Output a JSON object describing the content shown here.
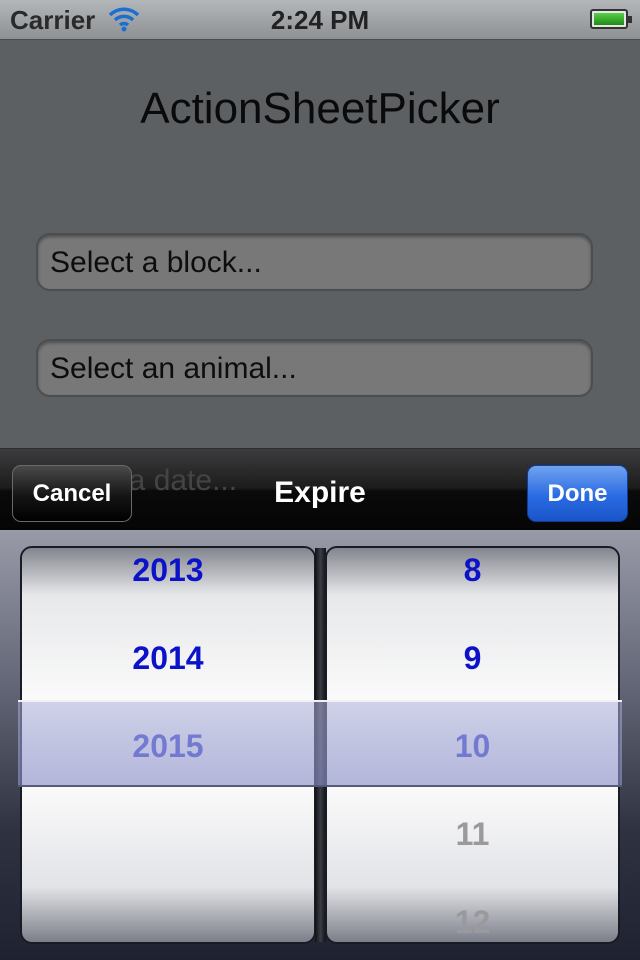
{
  "status_bar": {
    "carrier": "Carrier",
    "time": "2:24 PM"
  },
  "screen": {
    "title": "ActionSheetPicker",
    "fields": [
      "Select a block...",
      "Select an animal..."
    ],
    "obscured_field_fragment": "t a date..."
  },
  "toolbar": {
    "cancel_label": "Cancel",
    "title": "Expire",
    "done_label": "Done"
  },
  "picker": {
    "columns": [
      {
        "rows": [
          "2013",
          "2014",
          "2015"
        ],
        "selected": "2015"
      },
      {
        "rows": [
          "8",
          "9",
          "10",
          "11",
          "12"
        ],
        "selected": "10"
      }
    ]
  },
  "colors": {
    "picker_text": "#0b12c8",
    "done_button": "#2a6be3"
  }
}
